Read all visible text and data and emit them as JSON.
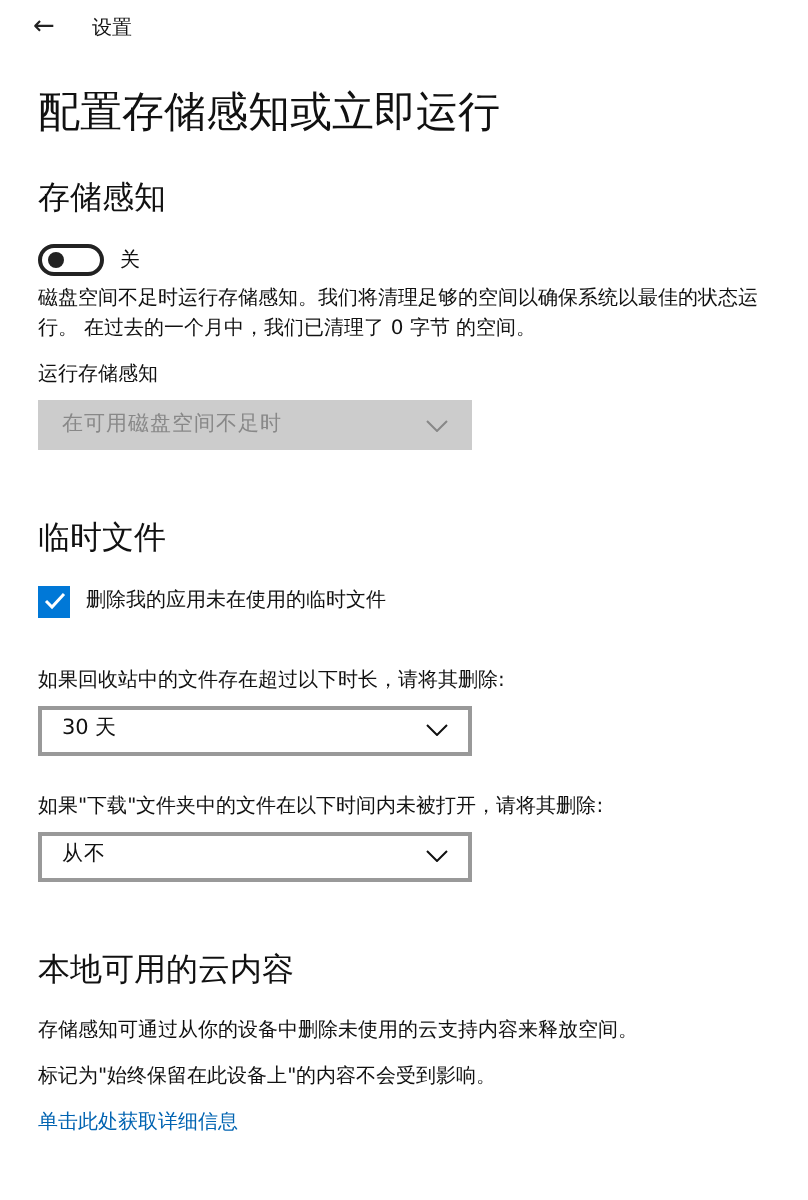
{
  "window": {
    "back": "←",
    "title": "设置"
  },
  "heading": "配置存储感知或立即运行",
  "sections": [
    {
      "title": "存储感知",
      "items": [
        {
          "kind": "toggle",
          "on": false,
          "label": "关"
        },
        {
          "kind": "text",
          "text": "磁盘空间不足时运行存储感知。我们将清理足够的空间以确保系统以最佳的状态运行。 在过去的一个月中，我们已清理了 0 字节 的空间。"
        },
        {
          "kind": "select",
          "label": "运行存储感知",
          "value": "在可用磁盘空间不足时",
          "disabled": true
        }
      ]
    },
    {
      "title": "临时文件",
      "items": [
        {
          "kind": "checkbox",
          "checked": true,
          "label": "删除我的应用未在使用的临时文件"
        },
        {
          "kind": "select",
          "label": "如果回收站中的文件存在超过以下时长，请将其删除:",
          "value": "30 天",
          "disabled": false
        },
        {
          "kind": "select",
          "label": "如果\"下载\"文件夹中的文件在以下时间内未被打开，请将其删除:",
          "value": "从不",
          "disabled": false
        }
      ]
    },
    {
      "title": "本地可用的云内容",
      "items": [
        {
          "kind": "text",
          "text": "存储感知可通过从你的设备中删除未使用的云支持内容来释放空间。"
        },
        {
          "kind": "text",
          "text": "标记为\"始终保留在此设备上\"的内容不会受到影响。"
        },
        {
          "kind": "link",
          "text": "单击此处获取详细信息"
        }
      ]
    }
  ]
}
